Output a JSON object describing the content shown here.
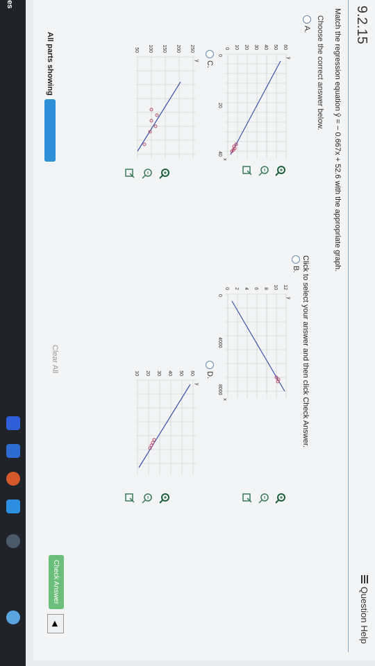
{
  "question": {
    "number": "9.2.15",
    "help_label": "Question Help",
    "prompt": "Match the regression equation ŷ = − 0.667x + 52.6 with the appropriate graph.",
    "choose_label": "Choose the correct answer below.",
    "instruction": "Click to select your answer and then click Check Answer."
  },
  "options": [
    {
      "letter": "A.",
      "yticks": [
        "60",
        "50",
        "40",
        "30",
        "20",
        "10",
        "0"
      ],
      "xticks": [
        "0",
        "20",
        "40"
      ],
      "axis_y": "y",
      "axis_x": "x"
    },
    {
      "letter": "B.",
      "yticks": [
        "12",
        "10",
        "8",
        "6",
        "4",
        "2",
        "0"
      ],
      "xticks": [
        "0",
        "4000",
        "8000"
      ],
      "axis_y": "y",
      "axis_x": "x"
    },
    {
      "letter": "C.",
      "yticks": [
        "250",
        "200",
        "150",
        "100",
        "50"
      ],
      "xticks": [],
      "axis_y": "y",
      "axis_x": ""
    },
    {
      "letter": "D.",
      "yticks": [
        "60",
        "50",
        "40",
        "30",
        "20",
        "10"
      ],
      "xticks": [],
      "axis_y": "y",
      "axis_x": ""
    }
  ],
  "footer": {
    "all_parts": "All parts showing",
    "clear_all": "Clear All",
    "check_answer": "Check Answer",
    "side_label": "ces"
  },
  "icons": [
    "zoom-in-icon",
    "zoom-out-icon",
    "popout-icon",
    "question-help-icon",
    "next-arrow-icon"
  ]
}
